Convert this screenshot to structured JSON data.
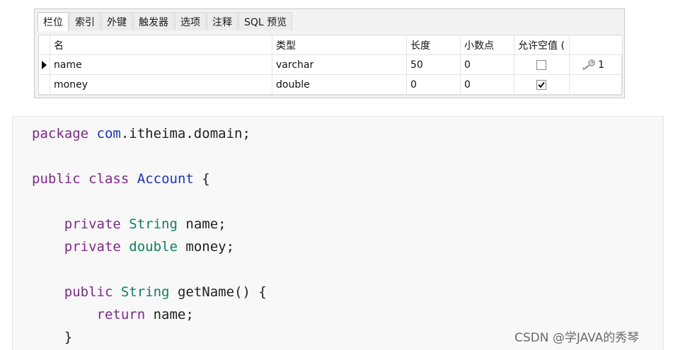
{
  "designer": {
    "tabs": [
      "栏位",
      "索引",
      "外键",
      "触发器",
      "选项",
      "注释",
      "SQL 预览"
    ],
    "active_tab": 0,
    "columns": [
      "名",
      "类型",
      "长度",
      "小数点",
      "允许空值 (",
      ""
    ],
    "rows": [
      {
        "name": "name",
        "type": "varchar",
        "length": "50",
        "decimals": "0",
        "allow_null": false,
        "key": "1",
        "selected": true
      },
      {
        "name": "money",
        "type": "double",
        "length": "0",
        "decimals": "0",
        "allow_null": true,
        "key": "",
        "selected": false
      }
    ]
  },
  "code": {
    "line1": {
      "kw": "package",
      "pkg": "com",
      "rest": ".itheima.domain;"
    },
    "line2": {
      "kw1": "public",
      "kw2": "class",
      "cls": "Account",
      "rest": "{"
    },
    "line3": {
      "kw": "private",
      "ty": "String",
      "rest": "name;"
    },
    "line4": {
      "kw": "private",
      "ty": "double",
      "rest": "money;"
    },
    "line5": {
      "kw": "public",
      "ty": "String",
      "rest": "getName() {"
    },
    "line6": {
      "kw": "return",
      "rest": "name;"
    },
    "line7": {
      "rest": "}"
    }
  },
  "watermark": "CSDN @学JAVA的秀琴"
}
